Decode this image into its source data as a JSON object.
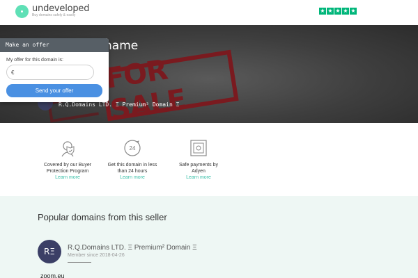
{
  "header": {
    "logo_text": "undeveloped",
    "logo_tagline": "Buy domains safely & easily",
    "trust_stars": 5,
    "star_glyph": "★",
    "trust_color": "#00b67a"
  },
  "hero": {
    "title": "name",
    "stamp_text": "FOR SALE",
    "seller_line": "R.Q.Domains LTD. Ξ Premium² Domain Ξ"
  },
  "offer": {
    "heading": "Make an offer",
    "label": "My offer for this domain is:",
    "currency": "€",
    "input_value": "",
    "button_label": "Send your offer",
    "button_color": "#4a90e2"
  },
  "features": [
    {
      "icon": "buyer-protection-icon",
      "text_line1": "Covered by our Buyer",
      "text_line2": "Protection Program",
      "link": "Learn more"
    },
    {
      "icon": "24-hours-icon",
      "text_line1": "Get this domain in less",
      "text_line2": "than 24 hours",
      "link": "Learn more"
    },
    {
      "icon": "secure-payment-icon",
      "text_line1": "Safe payments by",
      "text_line2": "Adyen",
      "link": "Learn more"
    }
  ],
  "popular": {
    "title": "Popular domains from this seller",
    "avatar_initials": "RΞ",
    "seller_name": "R.Q.Domains LTD. Ξ Premium² Domain Ξ",
    "member_since": "Member since 2018-04-26",
    "domain": "zoom.eu"
  }
}
